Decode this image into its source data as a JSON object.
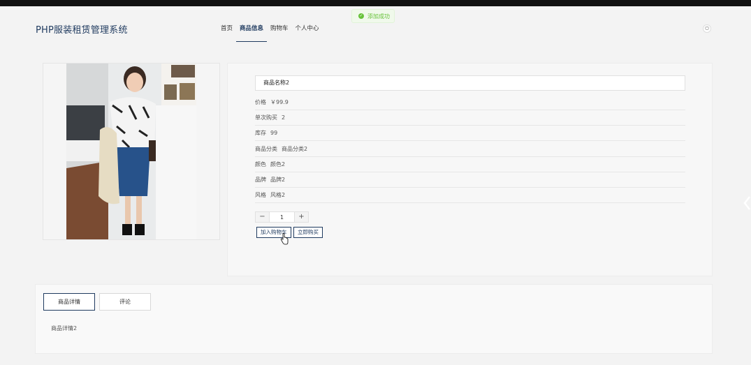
{
  "toast": {
    "message": "添加成功",
    "icon": "check-circle-icon"
  },
  "header": {
    "brand": "PHP服装租赁管理系统",
    "nav": [
      {
        "label": "首页",
        "active": false
      },
      {
        "label": "商品信息",
        "active": true
      },
      {
        "label": "购物车",
        "active": false
      },
      {
        "label": "个人中心",
        "active": false
      }
    ],
    "power_icon": "power-icon"
  },
  "product": {
    "name": "商品名称2",
    "attributes": [
      {
        "label": "价格",
        "value": "￥99.9"
      },
      {
        "label": "单次购买",
        "value": "2"
      },
      {
        "label": "库存",
        "value": "99"
      },
      {
        "label": "商品分类",
        "value": "商品分类2"
      },
      {
        "label": "颜色",
        "value": "颜色2"
      },
      {
        "label": "品牌",
        "value": "品牌2"
      },
      {
        "label": "风格",
        "value": "风格2"
      }
    ],
    "quantity": "1",
    "minus_label": "−",
    "plus_label": "+",
    "add_cart_label": "加入购物车",
    "buy_now_label": "立即购买"
  },
  "tabs": [
    {
      "label": "商品详情",
      "active": true
    },
    {
      "label": "评论",
      "active": false
    }
  ],
  "detail_text": "商品详情2"
}
